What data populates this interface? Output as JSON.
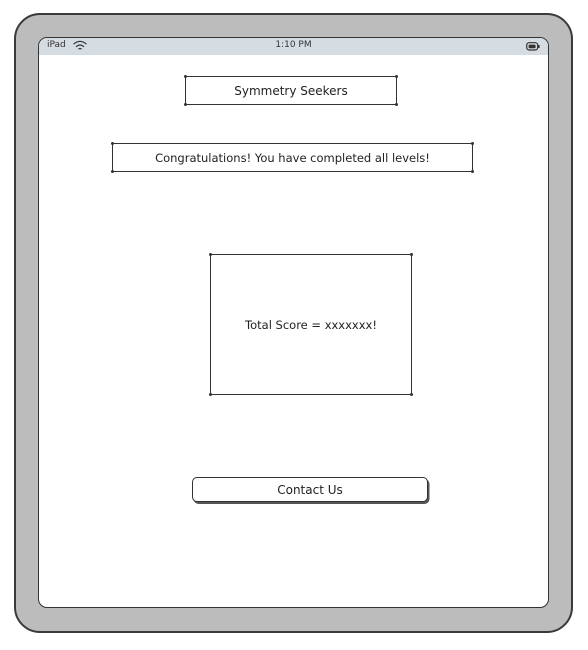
{
  "status_bar": {
    "device_label": "iPad",
    "time": "1:10 PM",
    "wifi_icon": "wifi-icon",
    "battery_icon": "battery-icon"
  },
  "app": {
    "title": "Symmetry Seekers",
    "message": "Congratulations! You have completed all levels!",
    "score_text": "Total Score = xxxxxxx!",
    "contact_button_label": "Contact Us"
  },
  "colors": {
    "device_frame": "#bcbcbc",
    "status_bar": "#d6dde2",
    "screen": "#ffffff",
    "ink": "#333333"
  }
}
